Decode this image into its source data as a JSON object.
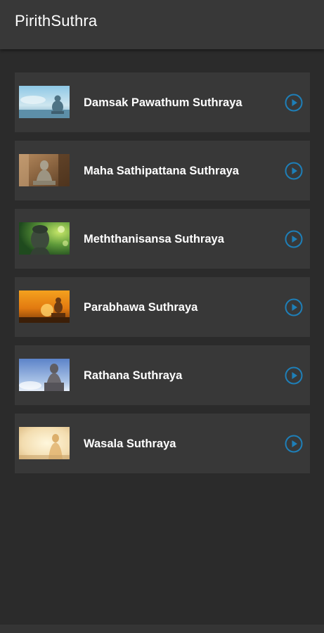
{
  "app": {
    "title": "PirithSuthra",
    "accent_color": "#1e7fb8",
    "background_color": "#2b2b2b",
    "card_color": "#383838"
  },
  "suthra_list": [
    {
      "title": "Damsak Pawathum Suthraya",
      "thumbnail": "buddha-statue-sky-thumbnail",
      "action_icon": "play-circle-icon"
    },
    {
      "title": "Maha Sathipattana Suthraya",
      "thumbnail": "buddha-rock-carving-thumbnail",
      "action_icon": "play-circle-icon"
    },
    {
      "title": "Meththanisansa Suthraya",
      "thumbnail": "buddha-face-green-thumbnail",
      "action_icon": "play-circle-icon"
    },
    {
      "title": "Parabhawa Suthraya",
      "thumbnail": "buddha-sunset-thumbnail",
      "action_icon": "play-circle-icon"
    },
    {
      "title": "Rathana Suthraya",
      "thumbnail": "buddha-statue-blue-sky-thumbnail",
      "action_icon": "play-circle-icon"
    },
    {
      "title": "Wasala Suthraya",
      "thumbnail": "buddha-golden-light-thumbnail",
      "action_icon": "play-circle-icon"
    }
  ]
}
